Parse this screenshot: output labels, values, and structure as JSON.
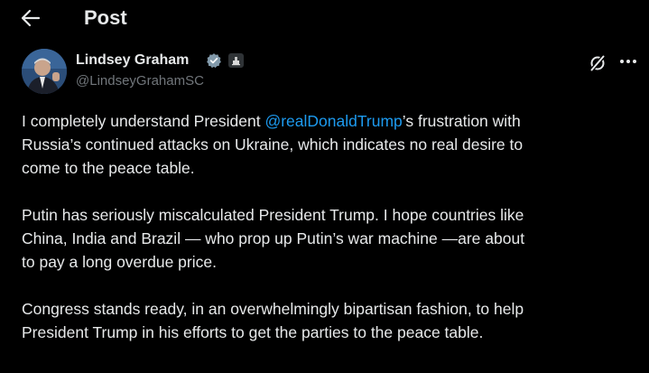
{
  "header": {
    "back_icon": "arrow-left-icon",
    "title": "Post"
  },
  "author": {
    "name": "Lindsey Graham",
    "handle": "@LindseyGrahamSC",
    "verified_icon": "verified-badge-icon",
    "affiliation_icon": "government-affiliation-icon",
    "accent_color": "#1d9bf0"
  },
  "actions": {
    "grok_icon": "grok-icon",
    "more_icon": "more-options-icon"
  },
  "tweet": {
    "p1": {
      "before": "I completely understand President ",
      "mention": "@realDonaldTrump",
      "after1": "’s frustration with",
      "line2": "Russia’s continued attacks on Ukraine, which indicates no real desire to",
      "line3": "come to the peace table."
    },
    "p2": {
      "line1": "Putin has seriously miscalculated President Trump. I hope countries like",
      "line2": "China, India and Brazil — who prop up Putin’s war machine —are about",
      "line3": "to pay a long overdue price."
    },
    "p3": {
      "line1": "Congress stands ready, in an overwhelmingly bipartisan fashion, to help",
      "line2": "President Trump in his efforts to get the parties to the peace table."
    }
  }
}
